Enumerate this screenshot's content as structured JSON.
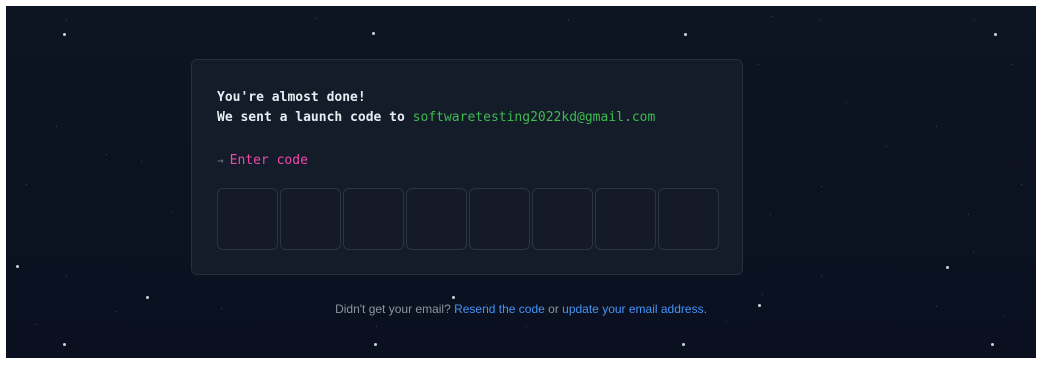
{
  "card": {
    "line1": "You're almost done!",
    "line2_prefix": "We sent a launch code to ",
    "email": "softwaretesting2022kd@gmail.com",
    "prompt_arrow": "→",
    "prompt_label": "Enter code",
    "code_length": 8
  },
  "footer": {
    "question": "Didn't get your email? ",
    "resend_link": "Resend the code",
    "or": " or ",
    "update_link": "update your email address",
    "period": "."
  },
  "colors": {
    "background": "#0b1220",
    "email": "#3fb950",
    "prompt": "#ea4aaa",
    "link": "#4493f8"
  },
  "icons": {
    "prompt": "right-arrow-icon"
  }
}
